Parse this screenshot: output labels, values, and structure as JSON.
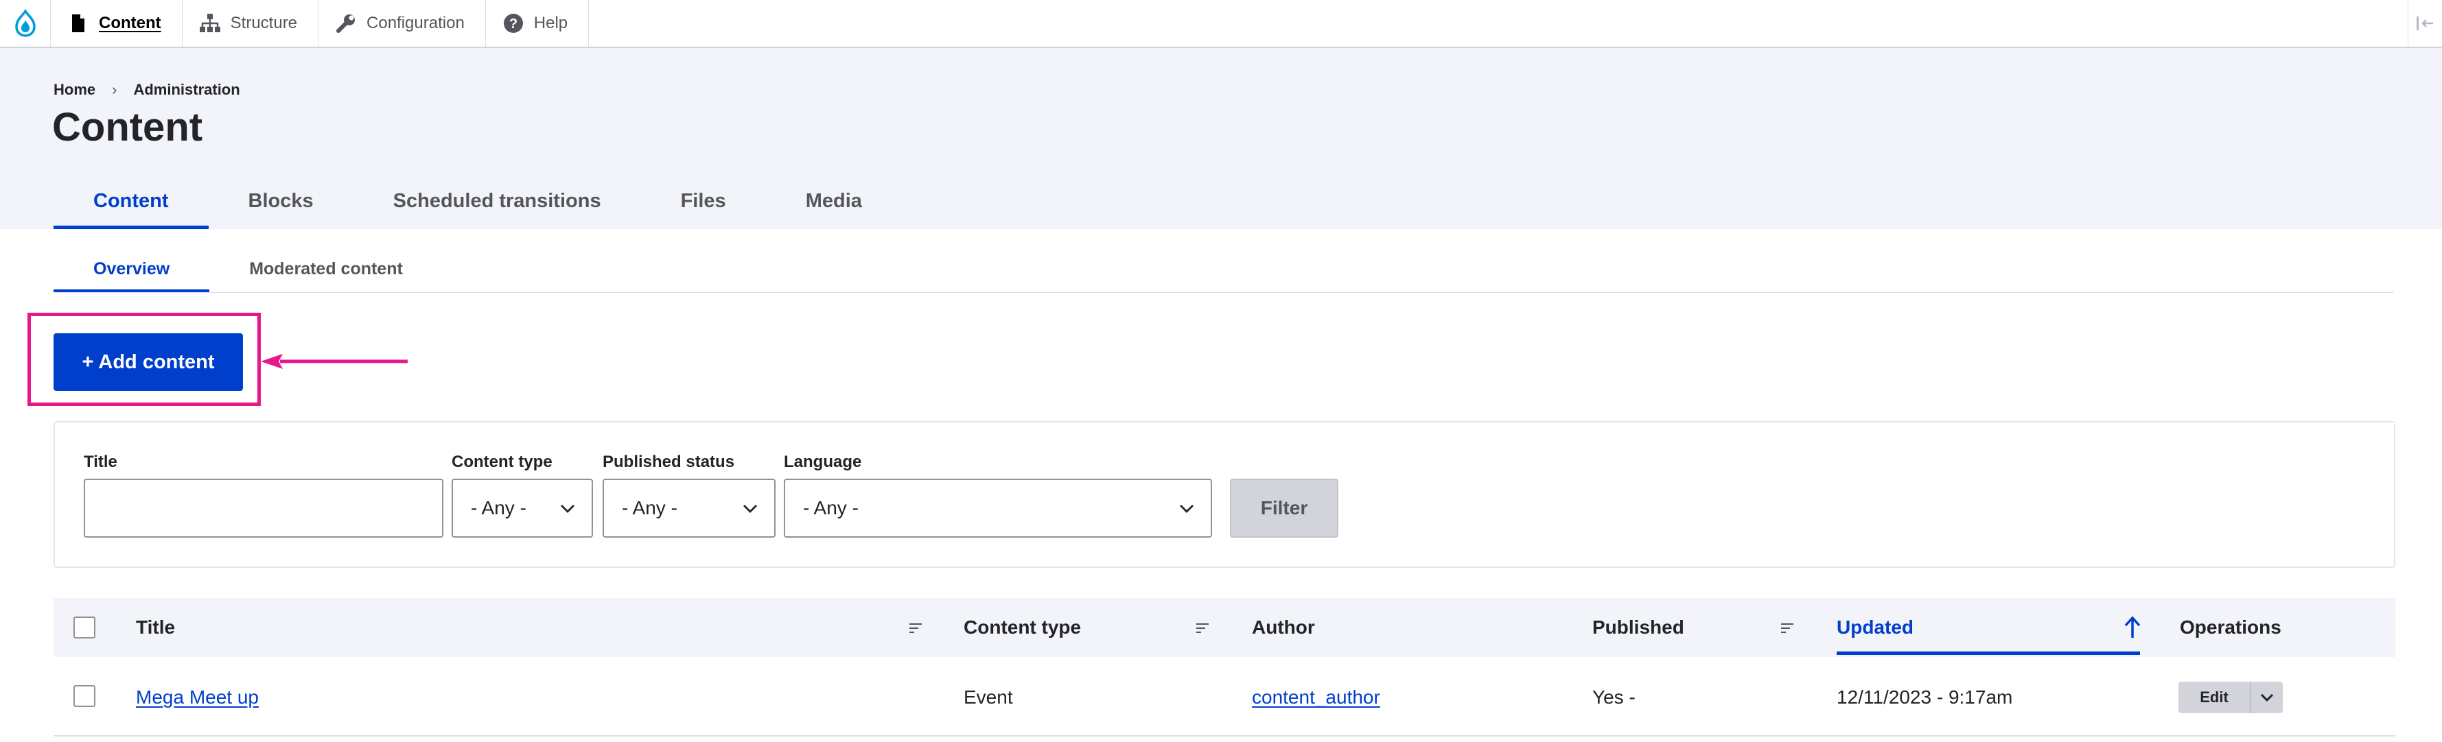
{
  "toolbar": {
    "logo_icon": "drupal-drop-icon",
    "items": [
      {
        "label": "Content",
        "icon": "file-icon",
        "active": true
      },
      {
        "label": "Structure",
        "icon": "sitemap-icon",
        "active": false
      },
      {
        "label": "Configuration",
        "icon": "wrench-icon",
        "active": false
      },
      {
        "label": "Help",
        "icon": "question-icon",
        "active": false
      }
    ],
    "toggle_icon": "collapse-orientation-icon"
  },
  "breadcrumb": {
    "items": [
      "Home",
      "Administration"
    ],
    "separator": "›"
  },
  "page": {
    "title": "Content"
  },
  "primary_tabs": [
    {
      "label": "Content",
      "active": true
    },
    {
      "label": "Blocks",
      "active": false
    },
    {
      "label": "Scheduled transitions",
      "active": false
    },
    {
      "label": "Files",
      "active": false
    },
    {
      "label": "Media",
      "active": false
    }
  ],
  "secondary_tabs": [
    {
      "label": "Overview",
      "active": true
    },
    {
      "label": "Moderated content",
      "active": false
    }
  ],
  "actions": {
    "add_content_label": "+ Add content"
  },
  "filters": {
    "title_label": "Title",
    "title_value": "",
    "content_type_label": "Content type",
    "content_type_value": "- Any -",
    "published_label": "Published status",
    "published_value": "- Any -",
    "language_label": "Language",
    "language_value": "- Any -",
    "filter_button": "Filter"
  },
  "table": {
    "columns": [
      "Title",
      "Content type",
      "Author",
      "Published",
      "Updated",
      "Operations"
    ],
    "sorted_column": "Updated",
    "rows": [
      {
        "title": "Mega Meet up",
        "content_type": "Event",
        "author": "content_author",
        "published": "Yes -",
        "updated": "12/11/2023 - 9:17am",
        "operation": "Edit"
      }
    ]
  },
  "colors": {
    "accent": "#003ecc",
    "highlight": "#e6198c",
    "header_bg": "#f3f4f9"
  }
}
